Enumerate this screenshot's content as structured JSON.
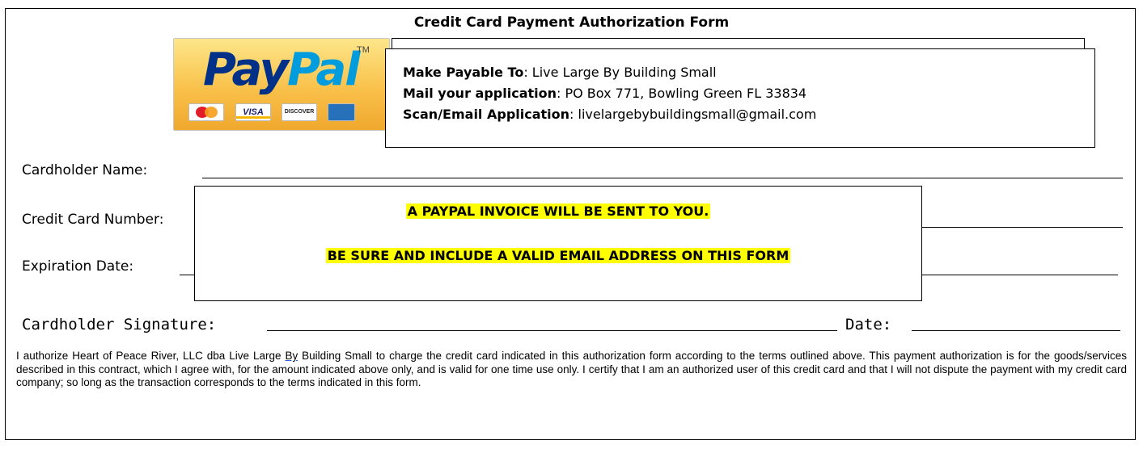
{
  "title": "Credit Card Payment Authorization Form",
  "paypal_logo": {
    "word_pay": "Pay",
    "word_pal": "Pal",
    "tm": "TM",
    "cards": [
      {
        "name": "mastercard-icon",
        "label": "MasterCard"
      },
      {
        "name": "visa-icon",
        "label": "VISA"
      },
      {
        "name": "discover-icon",
        "label": "DISCOVER"
      },
      {
        "name": "amex-icon",
        "label": "AMERICAN EXPRESS"
      }
    ]
  },
  "payable": {
    "payable_label": "Make Payable To",
    "payable_value": ":  Live Large By Building Small",
    "mail_label": "Mail your application",
    "mail_value": ": PO Box 771, Bowling Green FL 33834",
    "scan_label": "Scan/Email Application",
    "scan_value": ": livelargebybuildingsmall@gmail.com"
  },
  "fields": {
    "cardholder_name": "Cardholder Name:",
    "card_number": "Credit Card Number:",
    "expiration": "Expiration Date:",
    "signature": "Cardholder Signature:",
    "date": "Date:"
  },
  "notice": {
    "line1": "A PAYPAL INVOICE WILL BE SENT TO YOU.",
    "line2": "BE SURE AND INCLUDE A VALID EMAIL ADDRESS ON THIS FORM"
  },
  "authorization": {
    "part1": "I authorize Heart of Peace River, LLC dba Live Large ",
    "by": "By",
    "part2": " Building Small to charge the credit card indicated in this authorization form according to the terms outlined above. This payment authorization is for the goods/services described in this contract, which I agree with, for the amount indicated above only, and is valid for one time use only. I certify that I am an authorized user of this credit card and that I will not dispute the payment with my credit card company; so long as the transaction corresponds to the terms indicated in this form."
  },
  "colors": {
    "highlight": "#ffff00",
    "paypal_dark": "#003087",
    "paypal_light": "#009cde"
  }
}
